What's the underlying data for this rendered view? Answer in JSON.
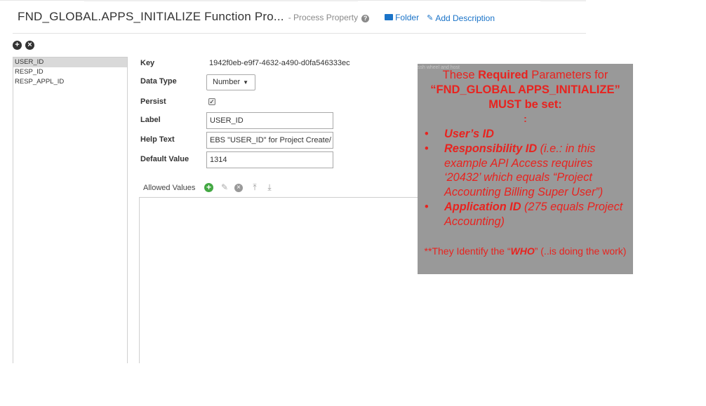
{
  "header": {
    "title": "FND_GLOBAL.APPS_INITIALIZE Function Pro...",
    "subtitle": "- Process Property",
    "folder_label": "Folder",
    "add_description_label": "Add Description"
  },
  "properties_list": {
    "items": [
      "USER_ID",
      "RESP_ID",
      "RESP_APPL_ID"
    ],
    "selected": "USER_ID"
  },
  "form": {
    "key_label": "Key",
    "key_value": "1942f0eb-e9f7-4632-a490-d0fa546333ec",
    "data_type_label": "Data Type",
    "data_type_value": "Number",
    "persist_label": "Persist",
    "persist_checked": true,
    "label_label": "Label",
    "label_value": "USER_ID",
    "help_text_label": "Help Text",
    "help_text_value": "EBS \"USER_ID\" for Project Create/",
    "default_value_label": "Default Value",
    "default_value_value": "1314",
    "allowed_values_label": "Allowed Values"
  },
  "note": {
    "faint_text": "ssh wheel and host",
    "head_pre": "These ",
    "head_bold1": "Required",
    "head_mid": " Parameters for",
    "head_line2": "“FND_GLOBAL APPS_INITIALIZE”",
    "head_line3": "MUST be set:",
    "colon": ":",
    "bullet1_bold": "User’s ID",
    "bullet2_bold": "Responsibility ID",
    "bullet2_rest": " (i.e.: in this example API Access requires ‘20432’ which equals “Project Accounting Billing Super User”)",
    "bullet3_bold": "Application ID",
    "bullet3_rest": " (275 equals Project Accounting)",
    "foot_pre": "**They Identify the “",
    "foot_bold": "WHO",
    "foot_post": "” (..is doing the work)"
  },
  "colors": {
    "note_text": "#e8231f",
    "note_bg": "#999999",
    "link": "#1a73c8",
    "add_green": "#43a843"
  }
}
